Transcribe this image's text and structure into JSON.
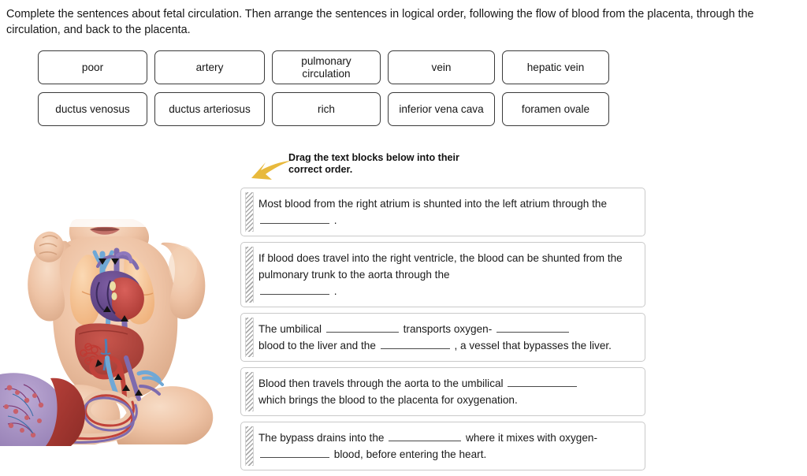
{
  "prompt": "Complete the sentences about fetal circulation. Then arrange the sentences in logical order, following the flow of blood from the placenta, through the circulation, and back to the placenta.",
  "word_bank": {
    "rows": [
      [
        {
          "label": "poor"
        },
        {
          "label": "artery"
        },
        {
          "label": "pulmonary\ncirculation"
        },
        {
          "label": "vein"
        },
        {
          "label": "hepatic vein"
        }
      ],
      [
        {
          "label": "ductus venosus"
        },
        {
          "label": "ductus arteriosus"
        },
        {
          "label": "rich"
        },
        {
          "label": "inferior vena cava"
        },
        {
          "label": "foramen ovale"
        }
      ]
    ]
  },
  "drag_note": {
    "text": "Drag the text blocks below into their\ncorrect order.",
    "arrow_color": "#E8B93C"
  },
  "blocks": [
    {
      "id": "block-1",
      "segments": [
        "Most blood from the right atrium is shunted into the left atrium through the ",
        "BLANK",
        " ."
      ]
    },
    {
      "id": "block-2",
      "segments": [
        "If blood does travel into the right ventricle, the blood can be shunted from the pulmonary trunk to the aorta through the ",
        "BLANK",
        " ."
      ]
    },
    {
      "id": "block-3",
      "segments": [
        "The umbilical ",
        "BLANK",
        " transports oxygen-",
        "BLANK",
        " blood to the liver and the ",
        "BLANK",
        " , a vessel that bypasses the liver."
      ]
    },
    {
      "id": "block-4",
      "segments": [
        "Blood then travels through the aorta to the umbilical ",
        "BLANK",
        " which brings the blood to the placenta for oxygenation."
      ]
    },
    {
      "id": "block-5",
      "segments": [
        "The bypass drains into the ",
        "BLANK",
        " where it mixes with oxygen-",
        "BLANK",
        " blood, before entering the heart."
      ]
    }
  ],
  "block_text": {
    "b1_p1": "Most blood from the right atrium is shunted into the left atrium through the",
    "b1_p2": ".",
    "b2_p1": "If blood does travel into the right ventricle, the blood can be shunted from the pulmonary trunk to the aorta through the",
    "b2_p2": ".",
    "b3_p1": "The umbilical",
    "b3_p2": "transports oxygen-",
    "b3_p3": "blood to the liver and the",
    "b3_p4": ", a vessel that bypasses the liver.",
    "b4_p1": "Blood then travels through the aorta to the umbilical",
    "b4_p2": "which brings the blood to the placenta for oxygenation.",
    "b5_p1": "The bypass drains into the",
    "b5_p2": "where it mixes with oxygen-",
    "b5_p3": "blood, before entering the heart."
  },
  "illustration": {
    "name": "fetal-circulation-diagram",
    "parts": [
      {
        "name": "infant-torso",
        "color": "#EEC3A5"
      },
      {
        "name": "left-lung",
        "color": "#F5C18D"
      },
      {
        "name": "right-lung",
        "color": "#F5C18D"
      },
      {
        "name": "heart-oxygenated-chamber",
        "color": "#C74B46"
      },
      {
        "name": "heart-deoxygenated-chamber",
        "color": "#6E4F92"
      },
      {
        "name": "superior-vena-cava",
        "color": "#6FA8D6"
      },
      {
        "name": "liver",
        "color": "#B4453F"
      },
      {
        "name": "umbilical-vein",
        "color": "#7E6BAE"
      },
      {
        "name": "umbilical-artery",
        "color": "#CF4B40"
      },
      {
        "name": "umbilical-cord",
        "color": "#EBC7AC"
      },
      {
        "name": "placenta",
        "color": "#A892C4"
      },
      {
        "name": "uterine-wall",
        "color": "#A33A33"
      }
    ]
  }
}
